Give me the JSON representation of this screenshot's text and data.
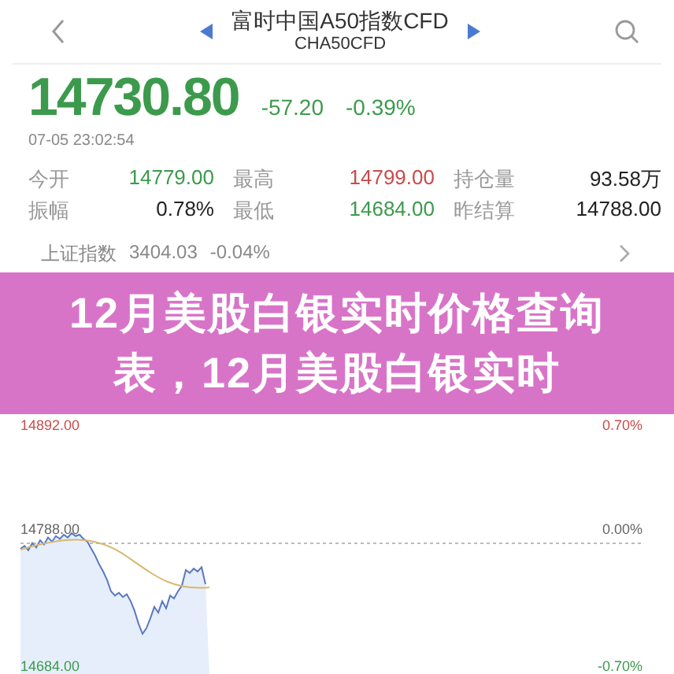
{
  "header": {
    "title": "富时中国A50指数CFD",
    "code": "CHA50CFD"
  },
  "quote": {
    "price": "14730.80",
    "change": "-57.20",
    "change_pct": "-0.39%",
    "time": "07-05 23:02:54"
  },
  "stats": [
    {
      "label": "今开",
      "value": "14779.00",
      "color": "#3c9a4c"
    },
    {
      "label": "最高",
      "value": "14799.00",
      "color": "#c94b4b"
    },
    {
      "label": "持仓量",
      "value": "93.58万",
      "color": "#222222"
    },
    {
      "label": "振幅",
      "value": "0.78%",
      "color": "#222222"
    },
    {
      "label": "最低",
      "value": "14684.00",
      "color": "#3c9a4c"
    },
    {
      "label": "昨结算",
      "value": "14788.00",
      "color": "#222222"
    }
  ],
  "index_row": {
    "name": "上证指数",
    "value": "3404.03",
    "change": "-0.04%"
  },
  "banner": {
    "text": "12月美股白银实时价格查询表，12月美股白银实时"
  },
  "chart": {
    "left_labels": [
      {
        "text": "14892.00",
        "color": "#c94b4b"
      },
      {
        "text": "14788.00",
        "color": "#666666"
      },
      {
        "text": "14684.00",
        "color": "#3c9a4c"
      }
    ],
    "right_labels": [
      {
        "text": "0.70%",
        "color": "#c94b4b"
      },
      {
        "text": "0.00%",
        "color": "#666666"
      },
      {
        "text": "-0.70%",
        "color": "#3c9a4c"
      }
    ]
  }
}
